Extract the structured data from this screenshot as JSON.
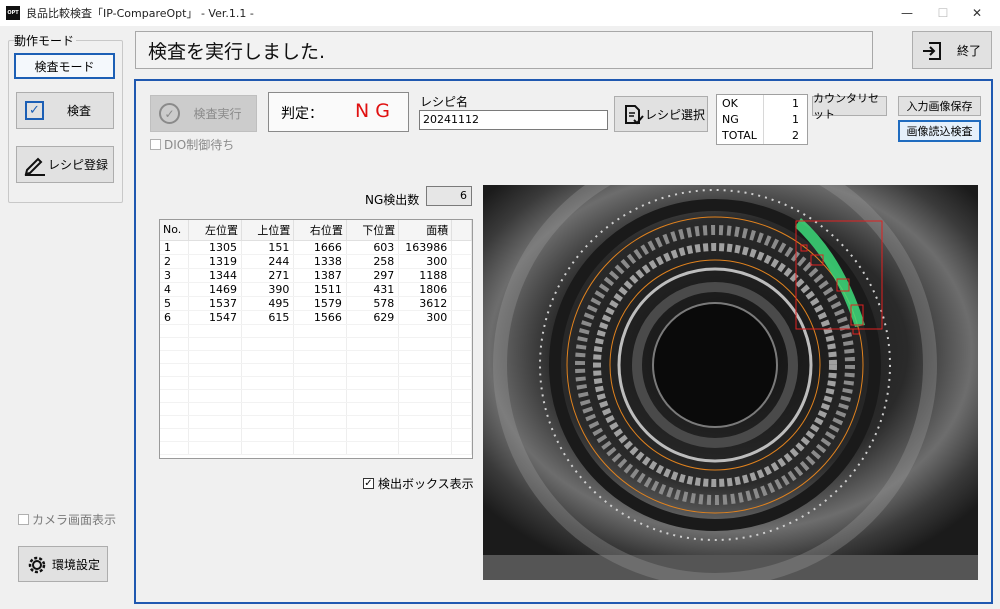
{
  "window": {
    "title": "良品比較検査「IP-CompareOpt」 - Ver.1.1 -",
    "logo_text": "OPT",
    "controls": {
      "minimize": "—",
      "maximize": "☐",
      "close": "✕"
    }
  },
  "mode_panel": {
    "title": "動作モード",
    "mode_button": "検査モード",
    "inspect_button": "検査",
    "recipe_register_button": "レシピ登録",
    "camera_view_checkbox": "カメラ画面表示",
    "settings_button": "環境設定"
  },
  "message": "検査を実行しました.",
  "exit_button": "終了",
  "inspection": {
    "run_button": "検査実行",
    "dio_checkbox": "DIO制御待ち",
    "judge_label": "判定：",
    "judge_value": "NG",
    "recipe_label": "レシピ名",
    "recipe_value": "20241112",
    "recipe_select_button": "レシピ選択"
  },
  "counter": {
    "rows": [
      {
        "label": "OK",
        "value": "1"
      },
      {
        "label": "NG",
        "value": "1"
      },
      {
        "label": "TOTAL",
        "value": "2"
      }
    ],
    "reset_button": "カウンタリセット"
  },
  "image_buttons": {
    "save_input": "入力画像保存",
    "load_inspect": "画像読込検査"
  },
  "ng_count": {
    "label": "NG検出数",
    "value": "6"
  },
  "table": {
    "headers": [
      "No.",
      "左位置",
      "上位置",
      "右位置",
      "下位置",
      "面積"
    ],
    "rows": [
      [
        "1",
        "1305",
        "151",
        "1666",
        "603",
        "163986"
      ],
      [
        "2",
        "1319",
        "244",
        "1338",
        "258",
        "300"
      ],
      [
        "3",
        "1344",
        "271",
        "1387",
        "297",
        "1188"
      ],
      [
        "4",
        "1469",
        "390",
        "1511",
        "431",
        "1806"
      ],
      [
        "5",
        "1537",
        "495",
        "1579",
        "578",
        "3612"
      ],
      [
        "6",
        "1547",
        "615",
        "1566",
        "629",
        "300"
      ]
    ]
  },
  "show_box_checkbox": "検出ボックス表示",
  "colors": {
    "accent": "#1f58b0",
    "ng_red": "#e01010",
    "detect_box": "#e02020",
    "ring_orange": "#e0821e",
    "defect_green": "#3ddc7a"
  }
}
